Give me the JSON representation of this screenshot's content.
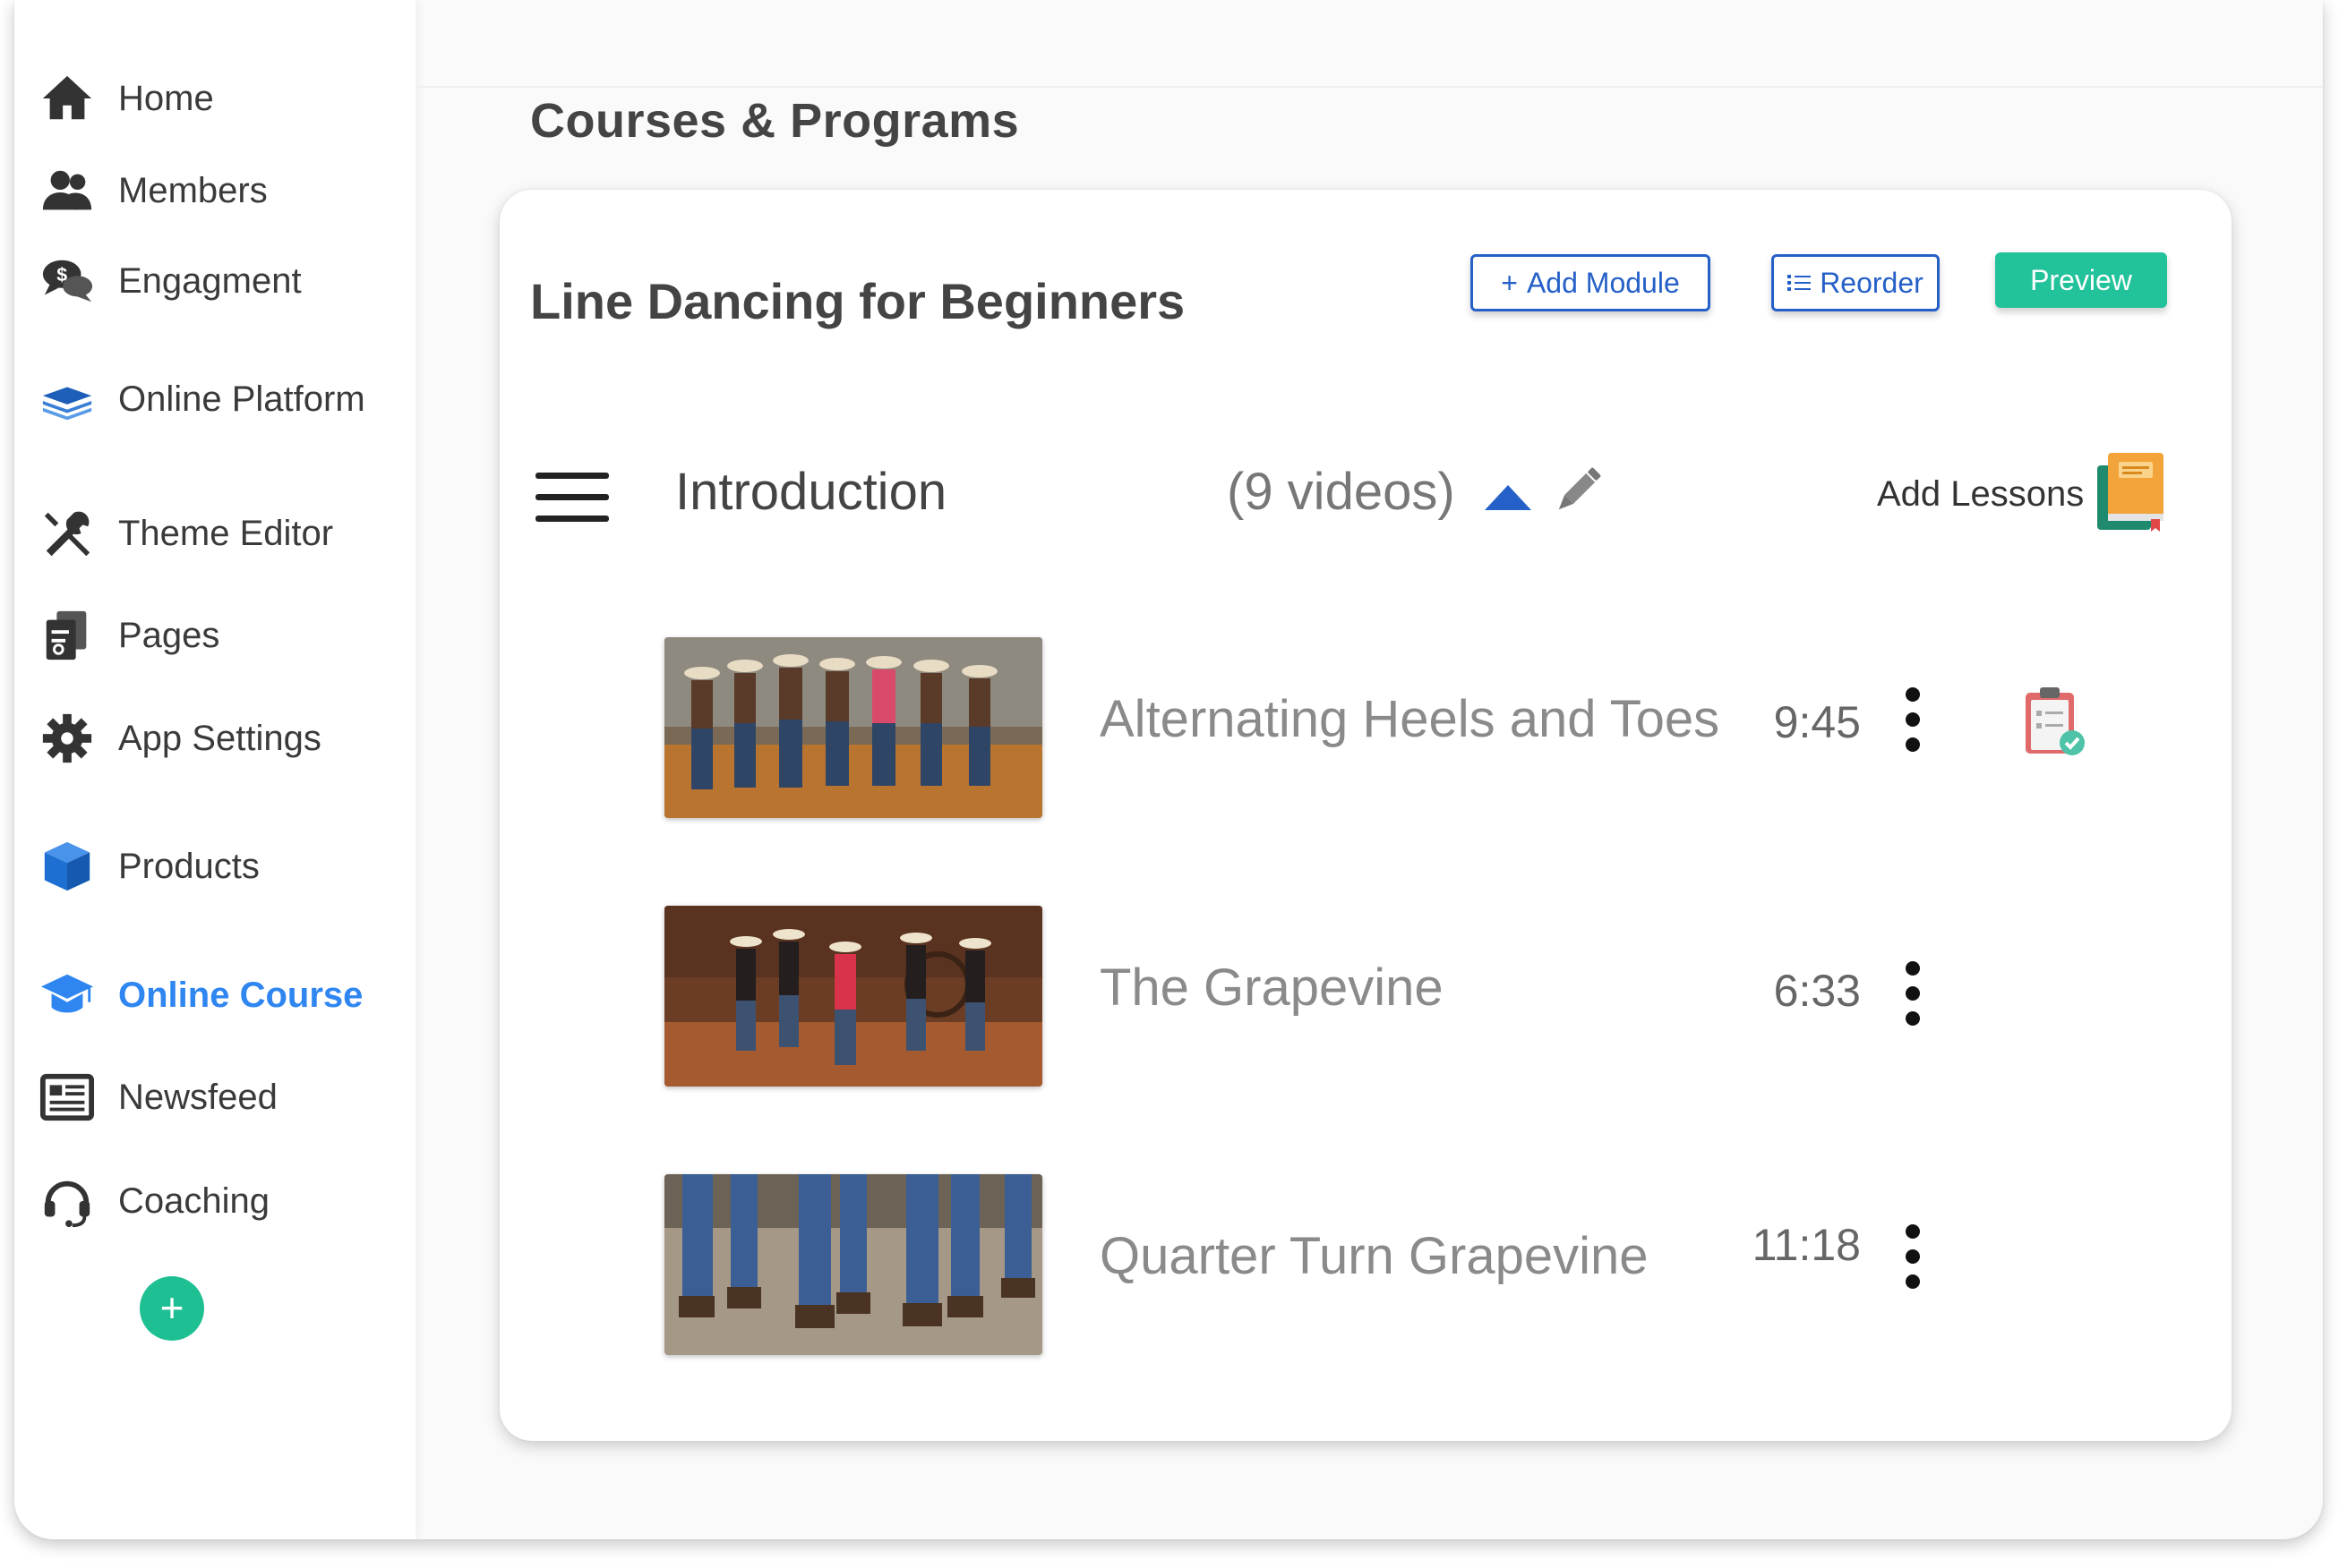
{
  "sidebar": {
    "items": [
      {
        "label": "Home",
        "icon": "home-icon"
      },
      {
        "label": "Members",
        "icon": "members-icon"
      },
      {
        "label": "Engagment",
        "icon": "engagement-icon"
      },
      {
        "label": "Online Platform",
        "icon": "layers-icon"
      },
      {
        "label": "Theme Editor",
        "icon": "tools-icon"
      },
      {
        "label": "Pages",
        "icon": "pages-icon"
      },
      {
        "label": "App Settings",
        "icon": "gear-icon"
      },
      {
        "label": "Products",
        "icon": "cube-icon"
      },
      {
        "label": "Online Course",
        "icon": "graduation-cap-icon",
        "active": true
      },
      {
        "label": "Newsfeed",
        "icon": "newspaper-icon"
      },
      {
        "label": "Coaching",
        "icon": "headset-icon"
      }
    ],
    "add_label": "+"
  },
  "page": {
    "title": "Courses & Programs"
  },
  "course": {
    "title": "Line Dancing for Beginners",
    "buttons": {
      "add_module": "Add Module",
      "add_module_icon": "+",
      "reorder": "Reorder",
      "preview": "Preview"
    }
  },
  "module": {
    "title": "Introduction",
    "count": "(9 videos)",
    "add_lessons": "Add Lessons"
  },
  "lessons": [
    {
      "title": "Alternating Heels and Toes",
      "duration": "9:45"
    },
    {
      "title": "The Grapevine",
      "duration": "6:33"
    },
    {
      "title": "Quarter Turn Grapevine",
      "duration": "11:18"
    }
  ],
  "colors": {
    "accent": "#2f86f0",
    "primary_blue": "#2560c8",
    "preview_green": "#22c29a",
    "add_green": "#1fbf94"
  }
}
